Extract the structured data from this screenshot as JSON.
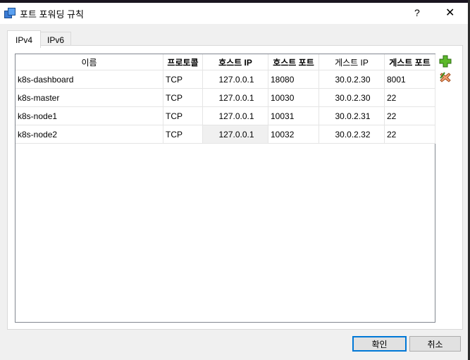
{
  "window": {
    "title": "포트 포워딩 규칙",
    "help": "?",
    "close": "✕"
  },
  "tabs": [
    {
      "label": "IPv4"
    },
    {
      "label": "IPv6"
    }
  ],
  "table": {
    "headers": [
      "이름",
      "프로토콜",
      "호스트 IP",
      "호스트 포트",
      "게스트 IP",
      "게스트 포트"
    ],
    "rows": [
      [
        "k8s-dashboard",
        "TCP",
        "127.0.0.1",
        "18080",
        "30.0.2.30",
        "8001"
      ],
      [
        "k8s-master",
        "TCP",
        "127.0.0.1",
        "10030",
        "30.0.2.30",
        "22"
      ],
      [
        "k8s-node1",
        "TCP",
        "127.0.0.1",
        "10031",
        "30.0.2.31",
        "22"
      ],
      [
        "k8s-node2",
        "TCP",
        "127.0.0.1",
        "10032",
        "30.0.2.32",
        "22"
      ]
    ]
  },
  "buttons": {
    "ok": "확인",
    "cancel": "취소"
  },
  "icons": {
    "add": "add-rule-icon",
    "remove": "remove-rule-icon"
  }
}
